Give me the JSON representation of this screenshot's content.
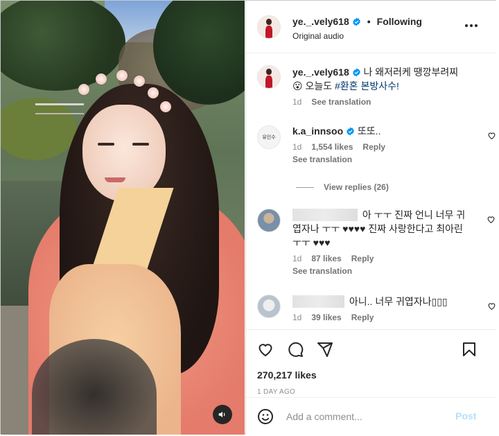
{
  "post": {
    "username": "ye._.vely618",
    "separator": "•",
    "follow_state": "Following",
    "audio": "Original audio",
    "likes": "270,217 likes",
    "date": "1 DAY AGO"
  },
  "caption": {
    "username": "ye._.vely618",
    "text": "나 왜저러케 땡깡부려찌😮 오늘도",
    "hashtag": "#환혼 본방사수!",
    "time": "1d",
    "see_translation": "See translation"
  },
  "comments": [
    {
      "username": "k.a_innsoo",
      "avatar_text": "유인수",
      "text": "또또..",
      "time": "1d",
      "likes": "1,554 likes",
      "reply": "Reply",
      "see_translation": "See translation",
      "view_replies": "View replies (26)"
    },
    {
      "username": "",
      "text": "아 ㅜㅜ 진짜 언니 너무 귀엽자나 ㅜㅜ ♥♥♥♥ 진짜 사랑한다고 최아린 ㅜㅜ ♥♥♥",
      "time": "1d",
      "likes": "87 likes",
      "reply": "Reply",
      "see_translation": "See translation"
    },
    {
      "username": "",
      "text": "아니.. 너무 귀엽자나▯▯▯",
      "time": "1d",
      "likes": "39 likes",
      "reply": "Reply"
    }
  ],
  "add_comment": {
    "placeholder": "Add a comment...",
    "post_label": "Post"
  },
  "icons": {
    "verified": "verified-badge-icon",
    "more": "more-options-icon",
    "heart": "heart-icon",
    "comment": "comment-icon",
    "share": "share-icon",
    "save": "bookmark-icon",
    "emoji": "emoji-icon",
    "mute": "speaker-icon"
  },
  "colors": {
    "accent_blue": "#0095f6",
    "post_disabled": "#b2dffc",
    "heart_red": "#c0182a",
    "hashtag": "#00376b"
  }
}
